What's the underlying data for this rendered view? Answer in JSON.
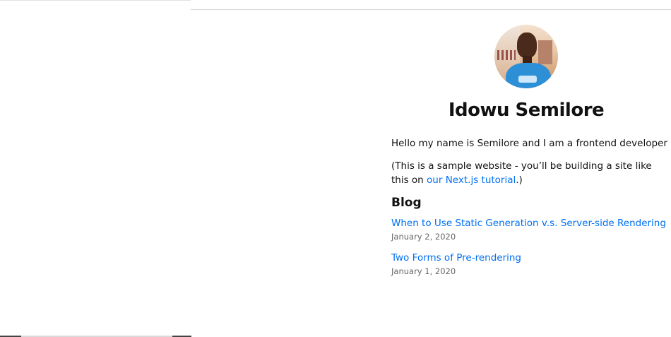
{
  "profile": {
    "name": "Idowu Semilore",
    "avatar_icon": "profile-photo"
  },
  "intro": {
    "greeting": "Hello my name is Semilore and I am a frontend developer",
    "note_prefix": "(This is a sample website - you’ll be building a site like this on ",
    "note_link": "our Next.js tutorial",
    "note_suffix": ".)"
  },
  "blog": {
    "heading": "Blog",
    "posts": [
      {
        "title": "When to Use Static Generation v.s. Server-side Rendering",
        "date": "January 2, 2020"
      },
      {
        "title": "Two Forms of Pre-rendering",
        "date": "January 1, 2020"
      }
    ]
  },
  "colors": {
    "link": "#0070f3",
    "date": "#666666",
    "text": "#111111"
  }
}
